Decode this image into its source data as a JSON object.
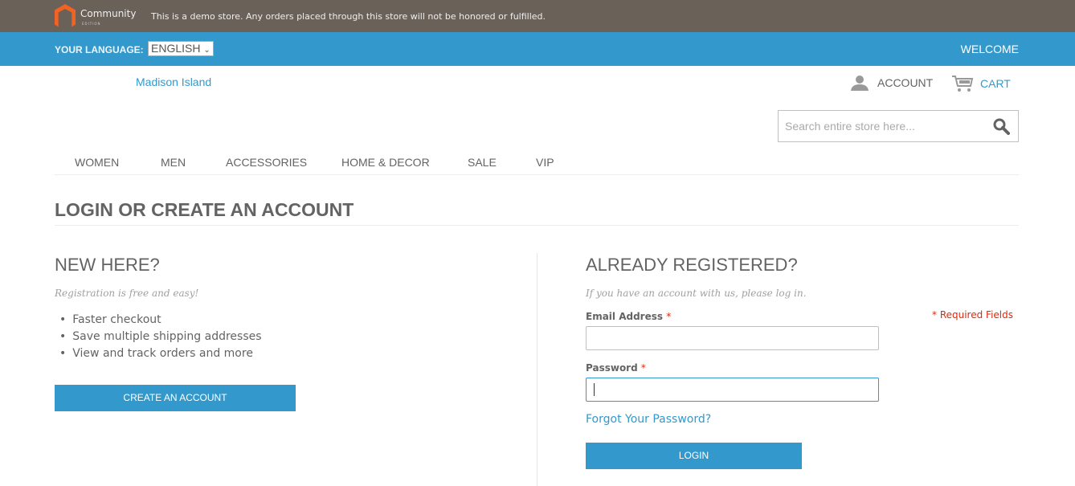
{
  "demo_notice": {
    "logo_text": "Community",
    "logo_subtext": "EDITION",
    "message": "This is a demo store. Any orders placed through this store will not be honored or fulfilled."
  },
  "lang_bar": {
    "label": "YOUR LANGUAGE:",
    "selected": "ENGLISH",
    "welcome": "WELCOME"
  },
  "header": {
    "brand": "Madison Island",
    "account": "ACCOUNT",
    "cart": "CART",
    "search_placeholder": "Search entire store here..."
  },
  "nav": [
    "WOMEN",
    "MEN",
    "ACCESSORIES",
    "HOME & DECOR",
    "SALE",
    "VIP"
  ],
  "page_title": "LOGIN OR CREATE AN ACCOUNT",
  "new_customer": {
    "heading": "NEW HERE?",
    "intro": "Registration is free and easy!",
    "benefits": [
      "Faster checkout",
      "Save multiple shipping addresses",
      "View and track orders and more"
    ],
    "button": "CREATE AN ACCOUNT"
  },
  "login": {
    "heading": "ALREADY REGISTERED?",
    "intro": "If you have an account with us, please log in.",
    "required_note": "* Required Fields",
    "email_label": "Email Address",
    "email_value": "",
    "password_label": "Password",
    "password_value": "",
    "required_mark": "*",
    "forgot": "Forgot Your Password?",
    "button": "LOGIN"
  },
  "colors": {
    "accent": "#3399cc",
    "demo_bar": "#6a6159",
    "required": "#df280a"
  }
}
